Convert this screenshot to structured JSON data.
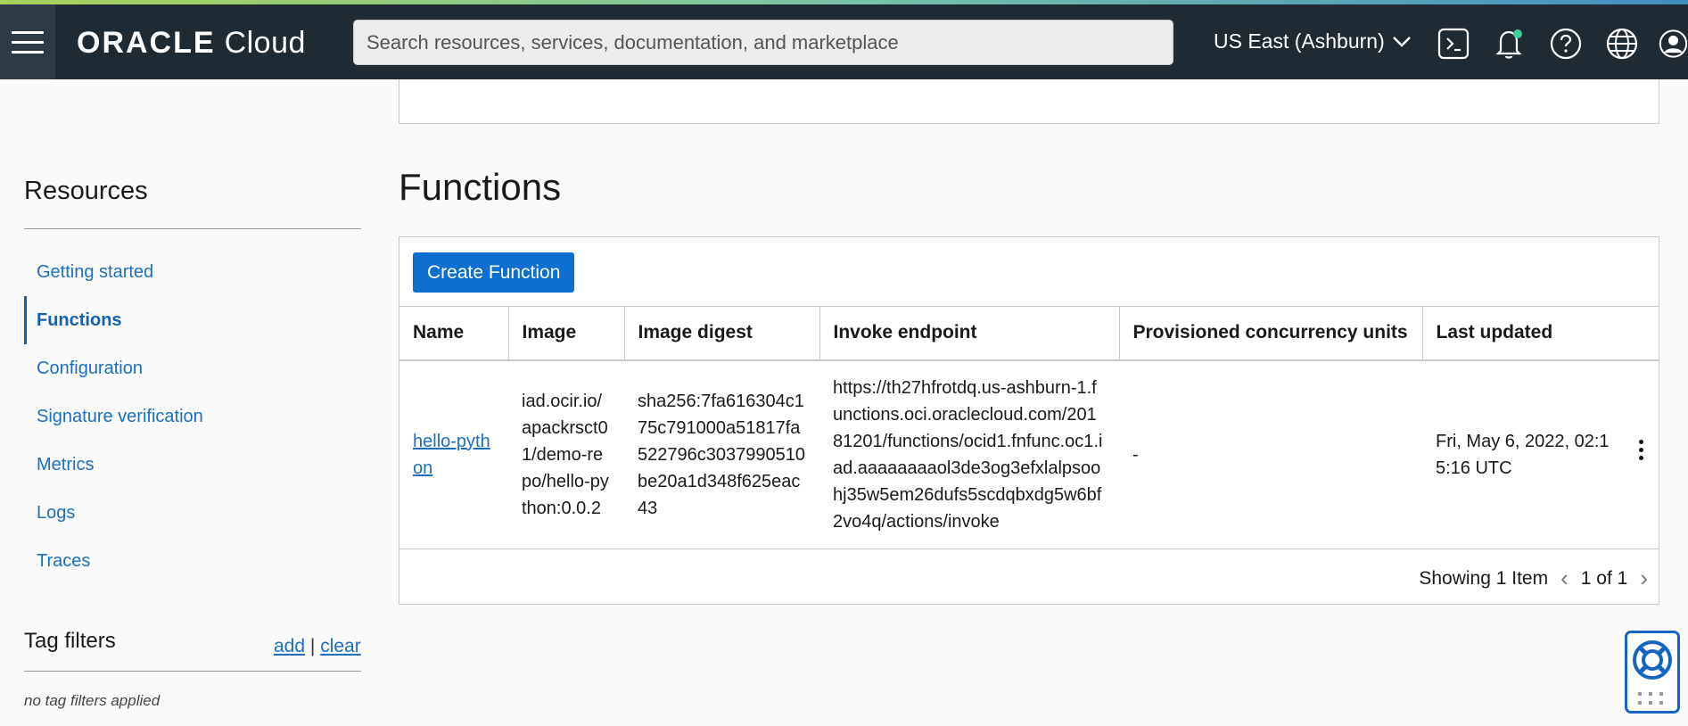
{
  "header": {
    "brand": "ORACLE",
    "product": "Cloud",
    "search_placeholder": "Search resources, services, documentation, and marketplace",
    "region": "US East (Ashburn)"
  },
  "sidebar": {
    "title": "Resources",
    "items": [
      {
        "label": "Getting started"
      },
      {
        "label": "Functions"
      },
      {
        "label": "Configuration"
      },
      {
        "label": "Signature verification"
      },
      {
        "label": "Metrics"
      },
      {
        "label": "Logs"
      },
      {
        "label": "Traces"
      }
    ],
    "tag_filters": {
      "title": "Tag filters",
      "add": "add",
      "separator": "|",
      "clear": "clear",
      "empty": "no tag filters applied"
    }
  },
  "main": {
    "title": "Functions",
    "create_button": "Create Function",
    "columns": [
      "Name",
      "Image",
      "Image digest",
      "Invoke endpoint",
      "Provisioned concurrency units",
      "Last updated"
    ],
    "rows": [
      {
        "name": "hello-python",
        "image": "iad.ocir.io/apackrsct01/demo-repo/hello-python:0.0.2",
        "digest": "sha256:7fa616304c175c791000a51817fa522796c3037990510be20a1d348f625eac43",
        "endpoint": "https://th27hfrotdq.us-ashburn-1.functions.oci.oraclecloud.com/20181201/functions/ocid1.fnfunc.oc1.iad.aaaaaaaaol3de3og3efxlalpsoohj35w5em26dufs5scdqbxdg5w6bf2vo4q/actions/invoke",
        "concurrency": "-",
        "updated": "Fri, May 6, 2022, 02:15:16 UTC"
      }
    ],
    "pager": {
      "showing": "Showing 1 Item",
      "page": "1 of 1"
    }
  }
}
